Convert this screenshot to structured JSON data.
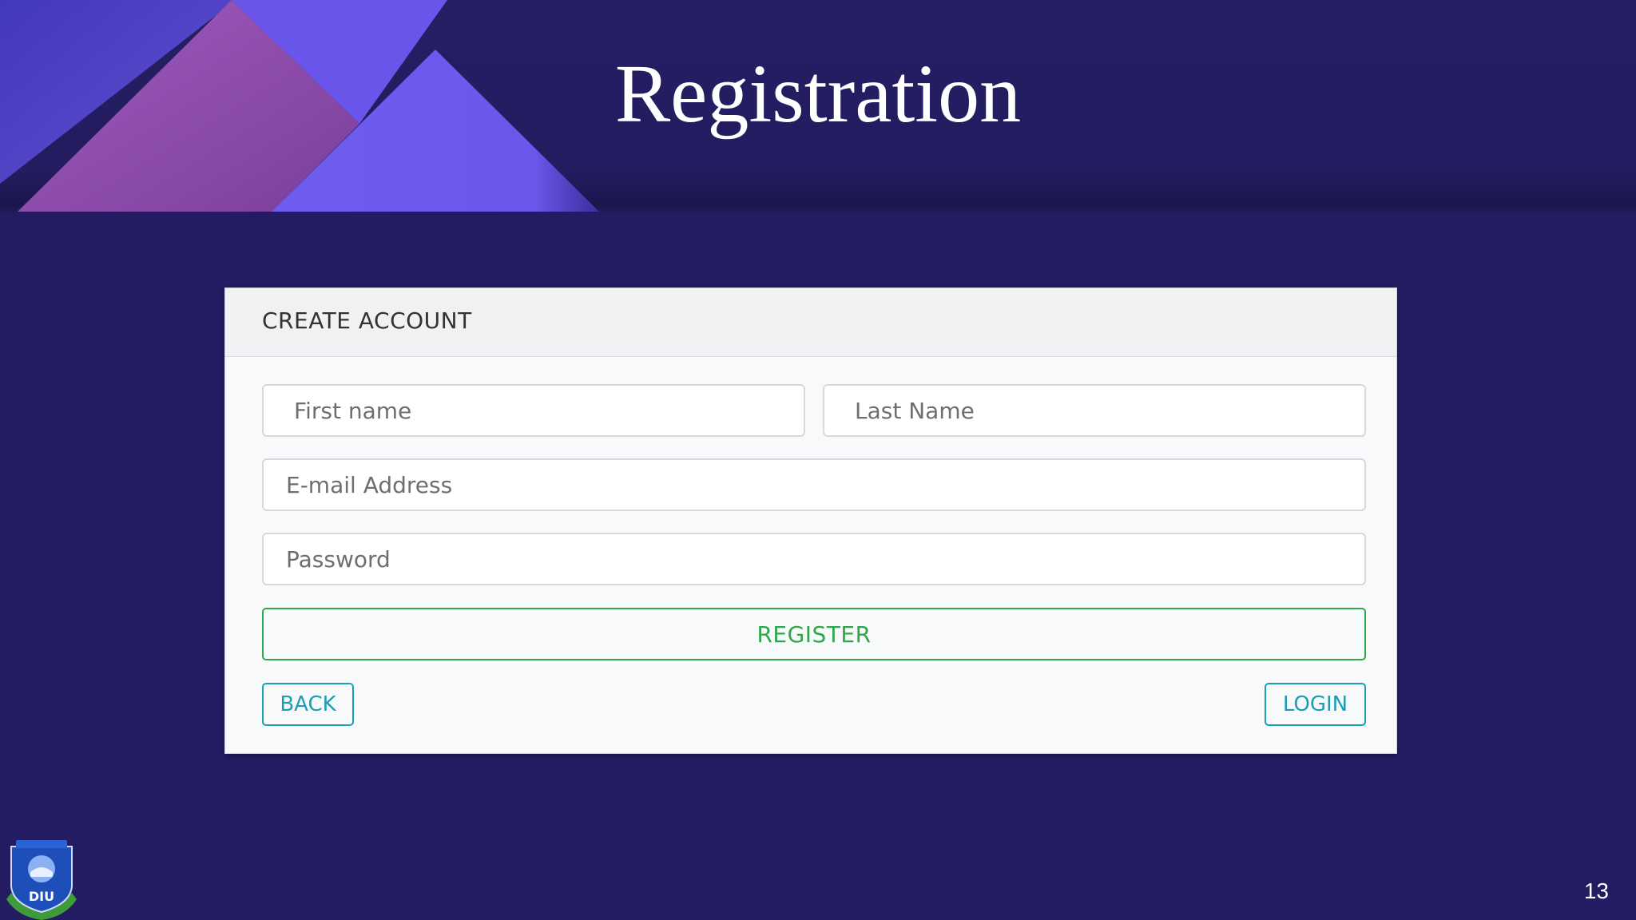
{
  "slide": {
    "title": "Registration",
    "page_number": "13"
  },
  "form": {
    "header": "CREATE ACCOUNT",
    "first_name_placeholder": "First name",
    "last_name_placeholder": "Last Name",
    "email_placeholder": "E-mail Address",
    "password_placeholder": "Password",
    "register_label": "REGISTER",
    "back_label": "BACK",
    "login_label": "LOGIN"
  },
  "logo": {
    "icon": "university-crest-icon",
    "letters": "DIU"
  },
  "colors": {
    "background": "#231c63",
    "register_accent": "#2ea84a",
    "nav_accent": "#19a0b5",
    "banner_violet": "#7357f0",
    "banner_magenta": "#8e4aa6"
  }
}
